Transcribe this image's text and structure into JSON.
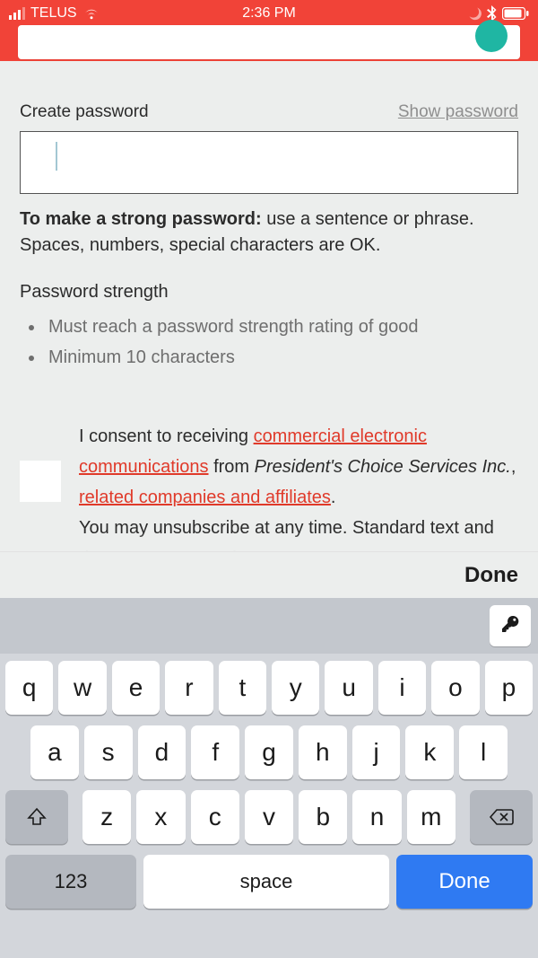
{
  "status": {
    "carrier": "TELUS",
    "time": "2:36 PM"
  },
  "password": {
    "label": "Create password",
    "show_label": "Show password",
    "value": "",
    "tip_bold": "To make a strong password:",
    "tip_rest": " use a sentence or phrase. Spaces, numbers, special characters are OK.",
    "strength_heading": "Password strength",
    "requirements": [
      "Must reach a password strength rating of good",
      "Minimum 10 characters"
    ]
  },
  "consent": {
    "pre": "I consent to receiving ",
    "link1": "commercial electronic communications",
    "mid1": " from ",
    "company": "President's Choice Services Inc.",
    "mid2": ", ",
    "link2": "related companies and affiliates",
    "mid3": ".",
    "tail": "You may unsubscribe at any time. Standard text and data rates may apply."
  },
  "keyboard": {
    "toolbar_done": "Done",
    "row1": [
      "q",
      "w",
      "e",
      "r",
      "t",
      "y",
      "u",
      "i",
      "o",
      "p"
    ],
    "row2": [
      "a",
      "s",
      "d",
      "f",
      "g",
      "h",
      "j",
      "k",
      "l"
    ],
    "row3": [
      "z",
      "x",
      "c",
      "v",
      "b",
      "n",
      "m"
    ],
    "num_label": "123",
    "space_label": "space",
    "action_label": "Done"
  }
}
